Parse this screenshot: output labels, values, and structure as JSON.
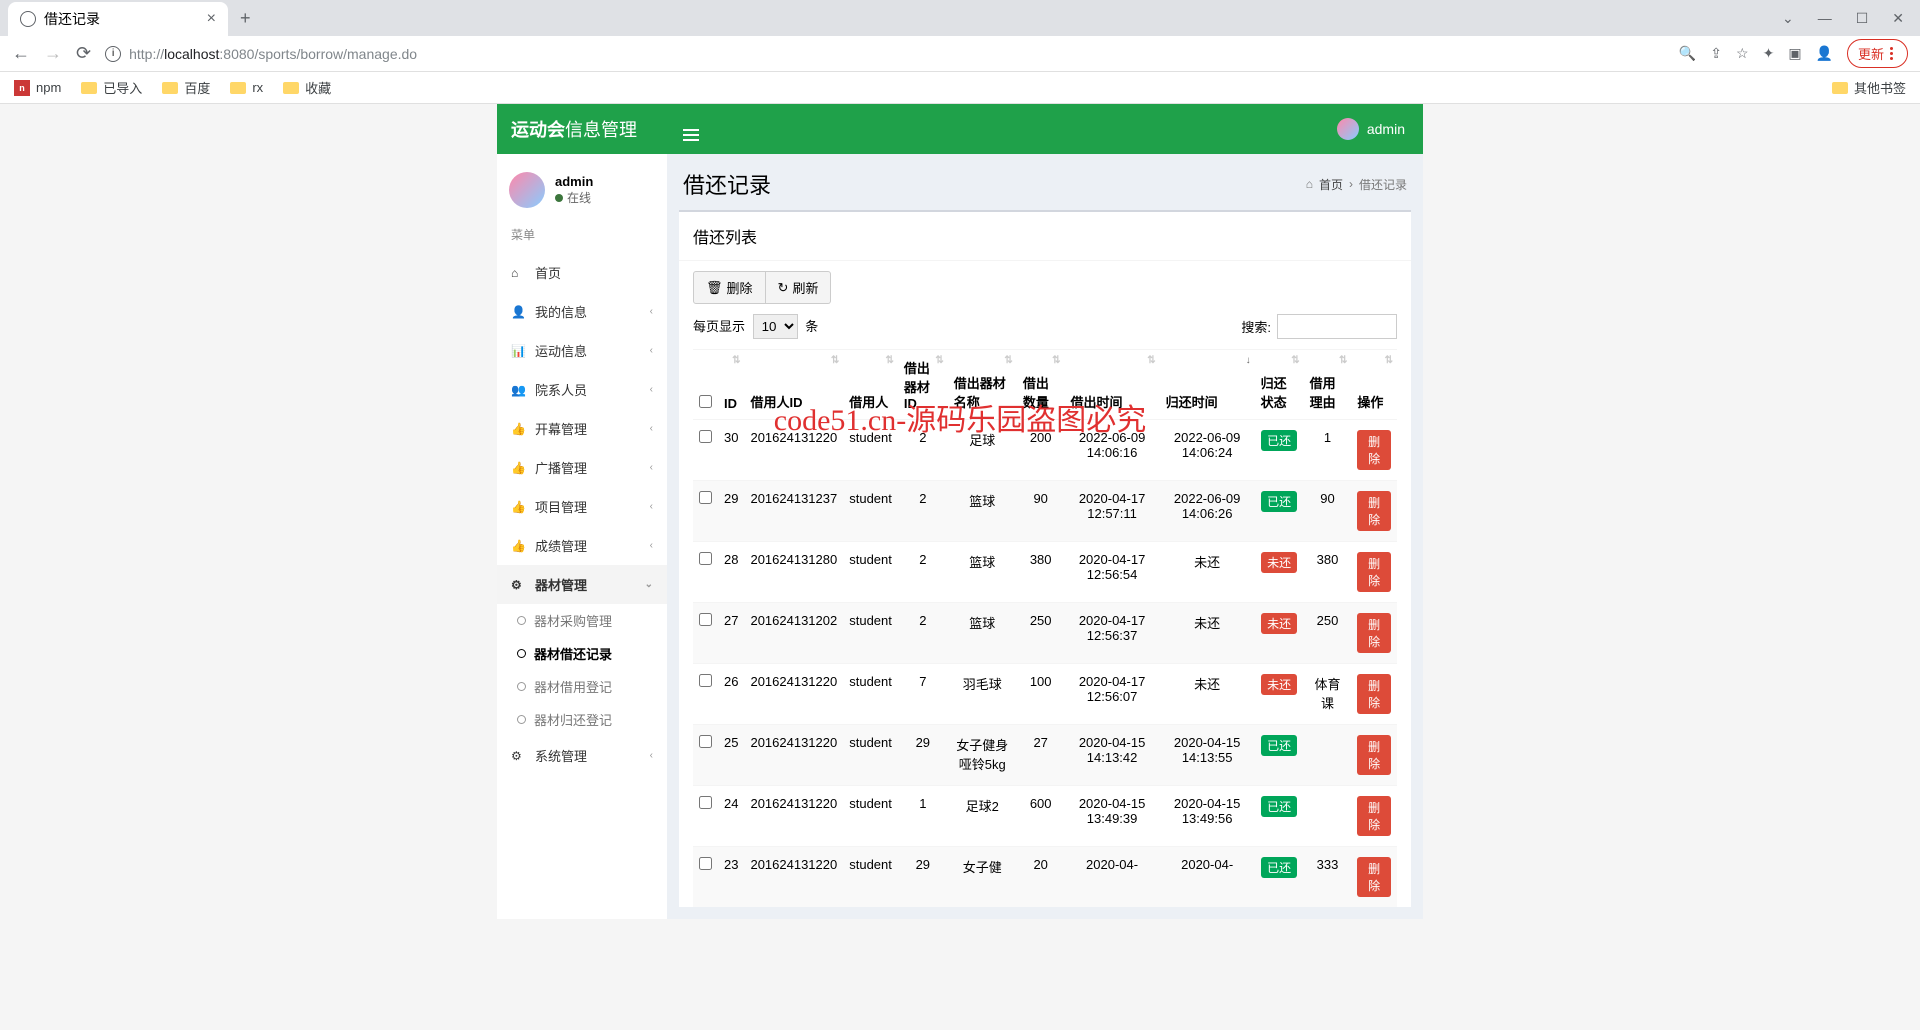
{
  "browser": {
    "tab_title": "借还记录",
    "url_prefix": "http://",
    "url_host": "localhost",
    "url_port": ":8080",
    "url_path": "/sports/borrow/manage.do",
    "update_label": "更新",
    "bookmarks": [
      "npm",
      "已导入",
      "百度",
      "rx",
      "收藏"
    ],
    "other_bookmarks": "其他书签"
  },
  "app": {
    "logo_bold": "运动会",
    "logo_light": "信息管理",
    "username": "admin",
    "online": "在线",
    "menu_header": "菜单",
    "menu": [
      {
        "icon": "⌂",
        "label": "首页",
        "chev": false
      },
      {
        "icon": "👤",
        "label": "我的信息",
        "chev": true
      },
      {
        "icon": "📊",
        "label": "运动信息",
        "chev": true
      },
      {
        "icon": "👥",
        "label": "院系人员",
        "chev": true
      },
      {
        "icon": "👍",
        "label": "开幕管理",
        "chev": true
      },
      {
        "icon": "👍",
        "label": "广播管理",
        "chev": true
      },
      {
        "icon": "👍",
        "label": "项目管理",
        "chev": true
      },
      {
        "icon": "👍",
        "label": "成绩管理",
        "chev": true
      }
    ],
    "active_menu": {
      "icon": "⚙",
      "label": "器材管理"
    },
    "submenu": [
      {
        "label": "器材采购管理",
        "active": false
      },
      {
        "label": "器材借还记录",
        "active": true
      },
      {
        "label": "器材借用登记",
        "active": false
      },
      {
        "label": "器材归还登记",
        "active": false
      }
    ],
    "menu_after": [
      {
        "icon": "⚙",
        "label": "系统管理",
        "chev": true
      }
    ]
  },
  "page": {
    "title": "借还记录",
    "breadcrumb_home": "首页",
    "breadcrumb_here": "借还记录",
    "box_title": "借还列表",
    "btn_delete": "删除",
    "btn_refresh": "刷新",
    "length_prefix": "每页显示",
    "length_suffix": "条",
    "length_value": "10",
    "search_label": "搜索:",
    "columns": [
      "",
      "ID",
      "借用人ID",
      "借用人",
      "借出器材ID",
      "借出器材名称",
      "借出数量",
      "借出时间",
      "归还时间",
      "归还状态",
      "借用理由",
      "操作"
    ],
    "status_returned": "已还",
    "status_not": "未还",
    "delete_label": "删除"
  },
  "rows": [
    {
      "id": "30",
      "uid": "201624131220",
      "user": "student",
      "eid": "2",
      "ename": "足球",
      "qty": "200",
      "btime": "2022-06-09 14:06:16",
      "rtime": "2022-06-09 14:06:24",
      "status": "已还",
      "reason": "1"
    },
    {
      "id": "29",
      "uid": "201624131237",
      "user": "student",
      "eid": "2",
      "ename": "篮球",
      "qty": "90",
      "btime": "2020-04-17 12:57:11",
      "rtime": "2022-06-09 14:06:26",
      "status": "已还",
      "reason": "90"
    },
    {
      "id": "28",
      "uid": "201624131280",
      "user": "student",
      "eid": "2",
      "ename": "篮球",
      "qty": "380",
      "btime": "2020-04-17 12:56:54",
      "rtime": "未还",
      "status": "未还",
      "reason": "380"
    },
    {
      "id": "27",
      "uid": "201624131202",
      "user": "student",
      "eid": "2",
      "ename": "篮球",
      "qty": "250",
      "btime": "2020-04-17 12:56:37",
      "rtime": "未还",
      "status": "未还",
      "reason": "250"
    },
    {
      "id": "26",
      "uid": "201624131220",
      "user": "student",
      "eid": "7",
      "ename": "羽毛球",
      "qty": "100",
      "btime": "2020-04-17 12:56:07",
      "rtime": "未还",
      "status": "未还",
      "reason": "体育课"
    },
    {
      "id": "25",
      "uid": "201624131220",
      "user": "student",
      "eid": "29",
      "ename": "女子健身哑铃5kg",
      "qty": "27",
      "btime": "2020-04-15 14:13:42",
      "rtime": "2020-04-15 14:13:55",
      "status": "已还",
      "reason": ""
    },
    {
      "id": "24",
      "uid": "201624131220",
      "user": "student",
      "eid": "1",
      "ename": "足球2",
      "qty": "600",
      "btime": "2020-04-15 13:49:39",
      "rtime": "2020-04-15 13:49:56",
      "status": "已还",
      "reason": ""
    },
    {
      "id": "23",
      "uid": "201624131220",
      "user": "student",
      "eid": "29",
      "ename": "女子健",
      "qty": "20",
      "btime": "2020-04-",
      "rtime": "2020-04-",
      "status": "已还",
      "reason": "333"
    }
  ],
  "watermark": "code51.cn-源码乐园盗图必究"
}
